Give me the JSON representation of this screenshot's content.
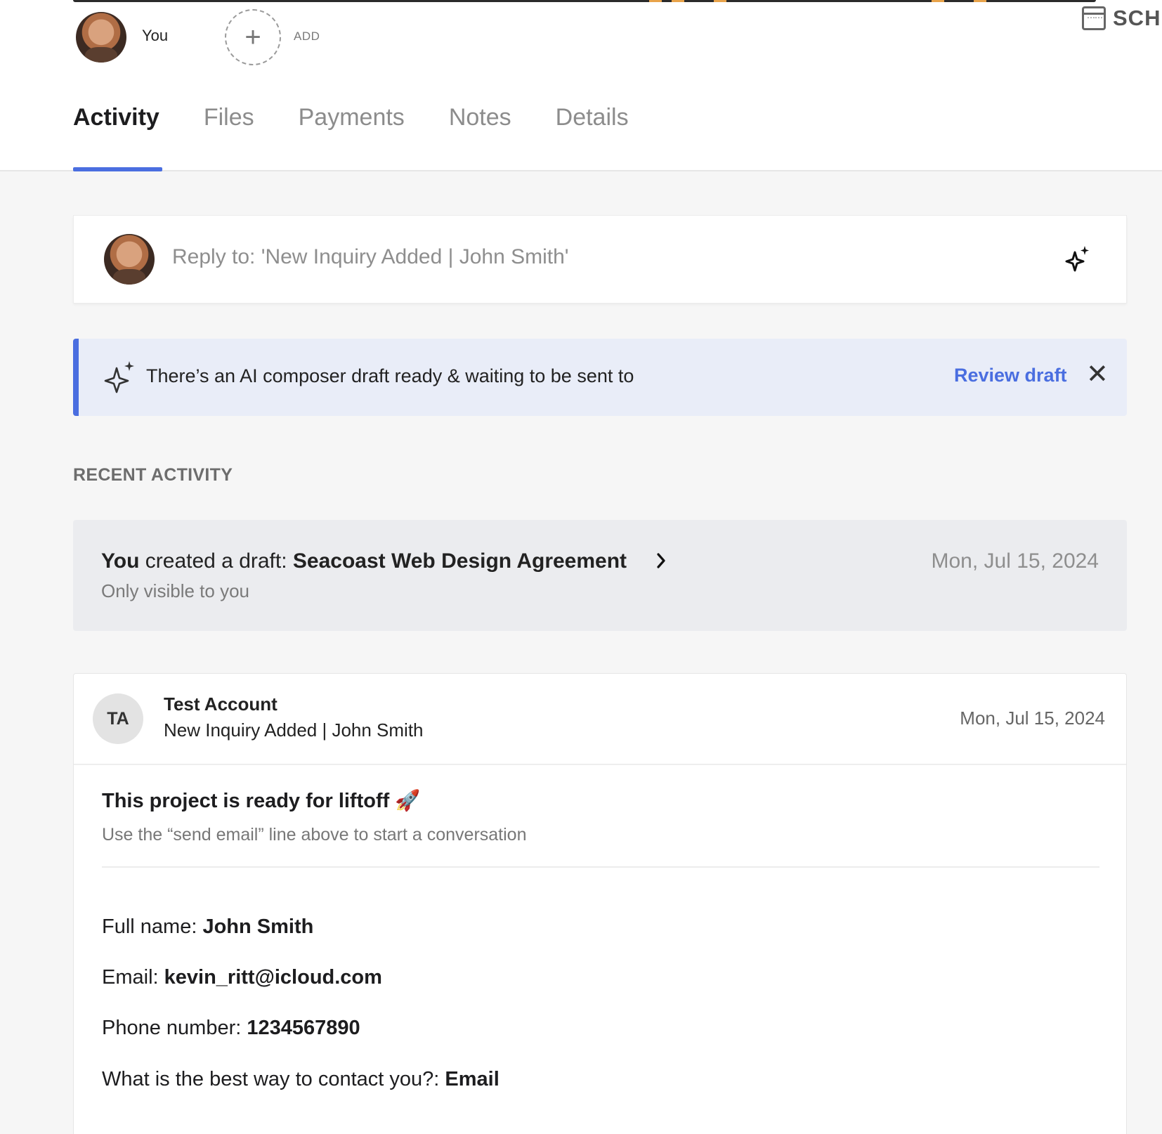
{
  "header": {
    "members": [
      {
        "label": "You"
      }
    ],
    "add_label": "ADD",
    "schedule_label": "SCHI"
  },
  "tabs": [
    {
      "label": "Activity",
      "active": true
    },
    {
      "label": "Files",
      "active": false
    },
    {
      "label": "Payments",
      "active": false
    },
    {
      "label": "Notes",
      "active": false
    },
    {
      "label": "Details",
      "active": false
    }
  ],
  "reply": {
    "placeholder": "Reply to: 'New Inquiry Added | John Smith'"
  },
  "ai_banner": {
    "text": "There’s an AI composer draft ready & waiting to be sent to",
    "action": "Review draft"
  },
  "recent_activity": {
    "title": "RECENT ACTIVITY",
    "draft": {
      "actor": "You",
      "action": " created a draft: ",
      "document": "Seacoast Web Design Agreement",
      "visibility": "Only visible to you",
      "date": "Mon, Jul 15, 2024"
    }
  },
  "email": {
    "initials": "TA",
    "sender": "Test Account",
    "subject": "New Inquiry Added | John Smith",
    "date": "Mon, Jul 15, 2024",
    "headline": "This project is ready for liftoff 🚀",
    "hint": "Use the “send email” line above to start a conversation",
    "fields": [
      {
        "label": "Full name: ",
        "value": "John Smith"
      },
      {
        "label": "Email: ",
        "value": "kevin_ritt@icloud.com"
      },
      {
        "label": "Phone number: ",
        "value": "1234567890"
      },
      {
        "label": "What is the best way to contact you?: ",
        "value": "Email"
      }
    ]
  },
  "colors": {
    "accent": "#4a6ee0",
    "banner_bg": "#e9edf8",
    "page_bg": "#f6f6f6"
  }
}
